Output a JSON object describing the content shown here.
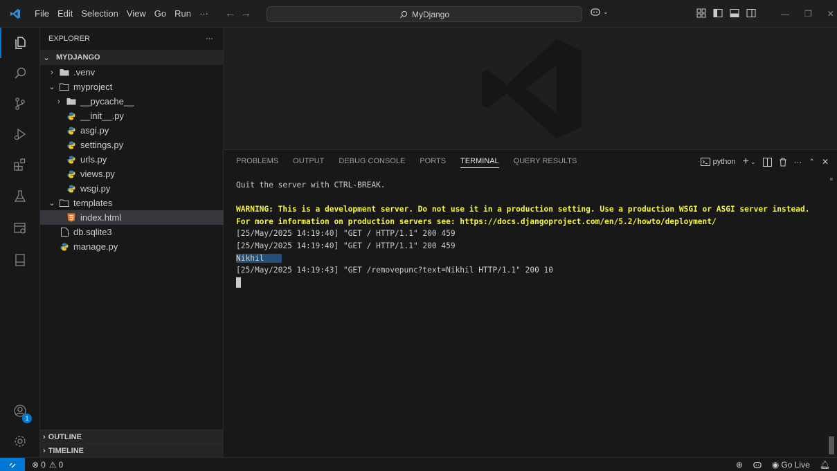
{
  "titlebar": {
    "menu": [
      "File",
      "Edit",
      "Selection",
      "View",
      "Go",
      "Run",
      "···"
    ],
    "search_text": "MyDjango"
  },
  "explorer": {
    "title": "EXPLORER",
    "more": "···",
    "root": "MYDJANGO",
    "tree": [
      {
        "label": ".venv",
        "indent": 1,
        "kind": "folder-closed",
        "chevron": "›"
      },
      {
        "label": "myproject",
        "indent": 1,
        "kind": "folder-open",
        "chevron": "⌄"
      },
      {
        "label": "__pycache__",
        "indent": 2,
        "kind": "folder-closed",
        "chevron": "›"
      },
      {
        "label": "__init__.py",
        "indent": 2,
        "kind": "python",
        "chevron": ""
      },
      {
        "label": "asgi.py",
        "indent": 2,
        "kind": "python",
        "chevron": ""
      },
      {
        "label": "settings.py",
        "indent": 2,
        "kind": "python",
        "chevron": ""
      },
      {
        "label": "urls.py",
        "indent": 2,
        "kind": "python",
        "chevron": ""
      },
      {
        "label": "views.py",
        "indent": 2,
        "kind": "python",
        "chevron": ""
      },
      {
        "label": "wsgi.py",
        "indent": 2,
        "kind": "python",
        "chevron": ""
      },
      {
        "label": "templates",
        "indent": 1,
        "kind": "folder-open",
        "chevron": "⌄"
      },
      {
        "label": "index.html",
        "indent": 2,
        "kind": "html",
        "chevron": "",
        "selected": true
      },
      {
        "label": "db.sqlite3",
        "indent": 1,
        "kind": "db",
        "chevron": ""
      },
      {
        "label": "manage.py",
        "indent": 1,
        "kind": "python",
        "chevron": ""
      }
    ],
    "outline": "OUTLINE",
    "timeline": "TIMELINE"
  },
  "panel": {
    "tabs": [
      "PROBLEMS",
      "OUTPUT",
      "DEBUG CONSOLE",
      "PORTS",
      "TERMINAL",
      "QUERY RESULTS"
    ],
    "active_tab": "TERMINAL",
    "terminal_name": "python",
    "lines": {
      "quit": "Quit the server with CTRL-BREAK.",
      "warn1": "WARNING: This is a development server. Do not use it in a production setting. Use a production WSGI or ASGI server instead.",
      "warn2": "For more information on production servers see: https://docs.djangoproject.com/en/5.2/howto/deployment/",
      "log1": "[25/May/2025 14:19:40] \"GET / HTTP/1.1\" 200 459",
      "log2": "[25/May/2025 14:19:40] \"GET / HTTP/1.1\" 200 459",
      "selected": "Nikhil",
      "log3": "[25/May/2025 14:19:43] \"GET /removepunc?text=Nikhil HTTP/1.1\" 200 10"
    }
  },
  "statusbar": {
    "errors": "0",
    "warnings": "0",
    "go_live": "Go Live"
  },
  "accounts_badge": "1",
  "colors": {
    "accent": "#0078d4",
    "warning_text": "#f5f543",
    "python_icon": "#f0c81e",
    "html_icon": "#e37933"
  }
}
